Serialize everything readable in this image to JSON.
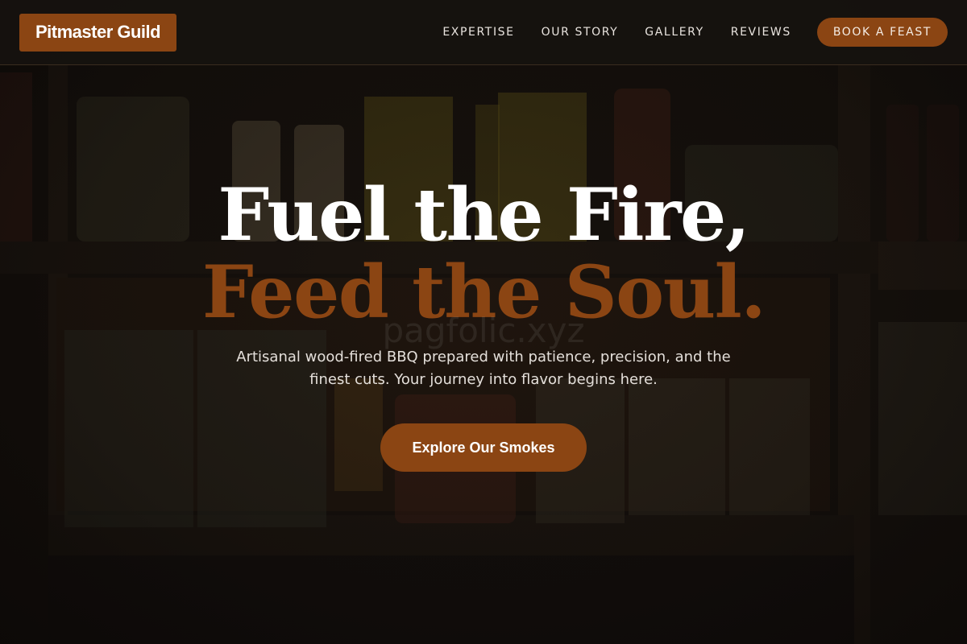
{
  "brand": {
    "name": "Pitmaster Guild",
    "color": "#8b4513"
  },
  "nav": {
    "links": [
      {
        "label": "EXPERTISE"
      },
      {
        "label": "OUR STORY"
      },
      {
        "label": "GALLERY"
      },
      {
        "label": "REVIEWS"
      }
    ],
    "cta_label": "BOOK A FEAST"
  },
  "hero": {
    "headline_line1": "Fuel the Fire,",
    "headline_line2": "Feed the Soul.",
    "watermark": "pagfolic.xyz",
    "subtitle": "Artisanal wood-fired BBQ prepared with patience, precision, and the finest cuts. Your journey into flavor begins here.",
    "cta_label": "Explore Our Smokes",
    "background_image": "pantry-shelves-photo"
  },
  "colors": {
    "accent": "#8b4513",
    "nav_bg": "#16120f",
    "text_light": "#ffffff"
  }
}
